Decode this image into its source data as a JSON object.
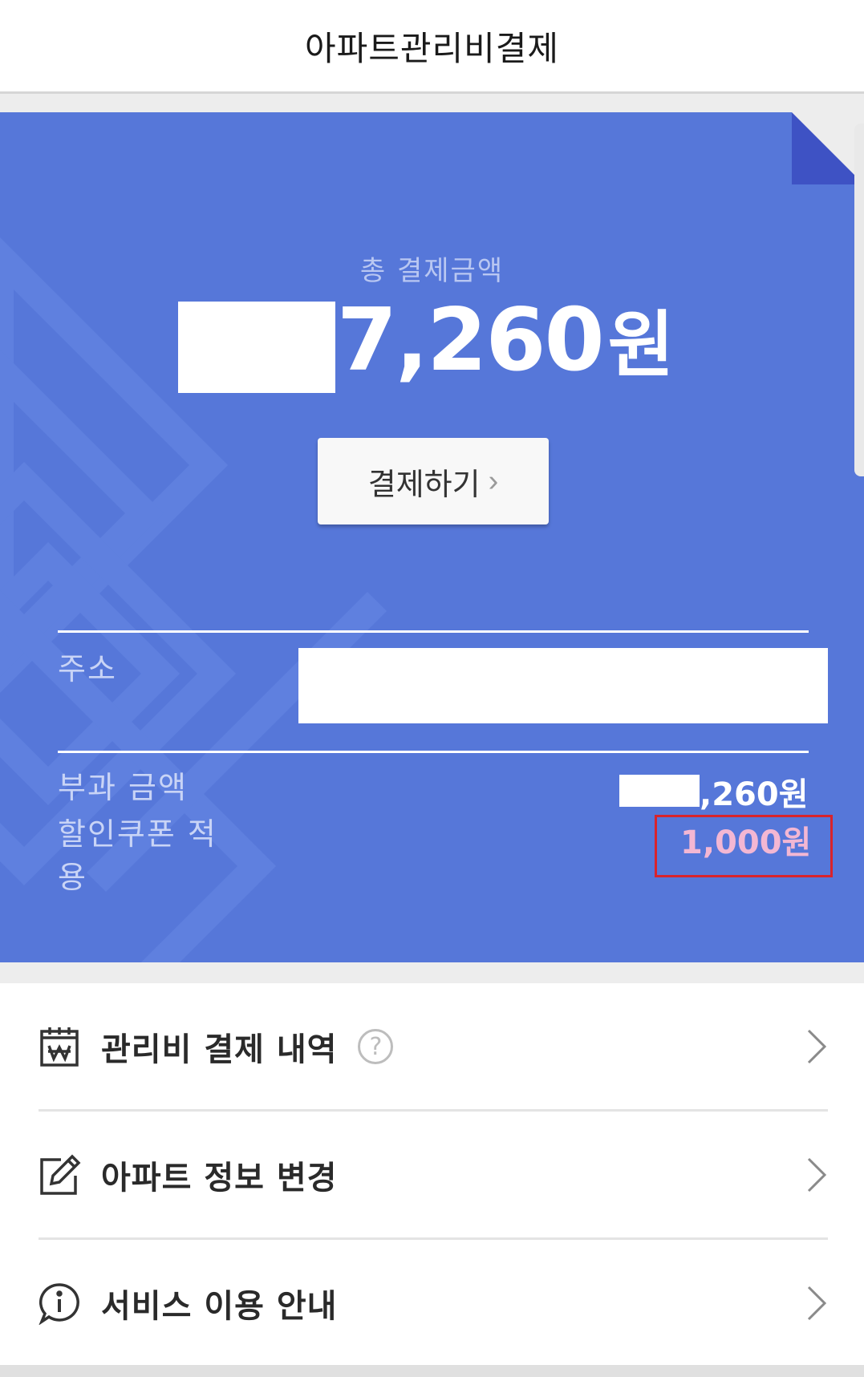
{
  "header": {
    "title": "아파트관리비결제"
  },
  "payment": {
    "total_label": "총 결제금액",
    "total_amount_visible": "7,260",
    "currency": "원",
    "pay_button_label": "결제하기",
    "pay_button_chevron": "›"
  },
  "details": {
    "address_label": "주소",
    "charge_label": "부과 금액",
    "charge_value_visible": ",260원",
    "coupon_label_line1": "할인쿠폰 적",
    "coupon_label_line2": "용",
    "coupon_value": "1,000원"
  },
  "menu": {
    "items": [
      {
        "label": "관리비 결제 내역",
        "icon": "calendar-won-icon",
        "help": "?"
      },
      {
        "label": "아파트 정보 변경",
        "icon": "edit-icon"
      },
      {
        "label": "서비스 이용 안내",
        "icon": "info-chat-icon"
      }
    ]
  },
  "colors": {
    "card_bg": "#5677d9",
    "highlight_border": "#d9232c",
    "coupon_text": "#f3b7d3"
  }
}
